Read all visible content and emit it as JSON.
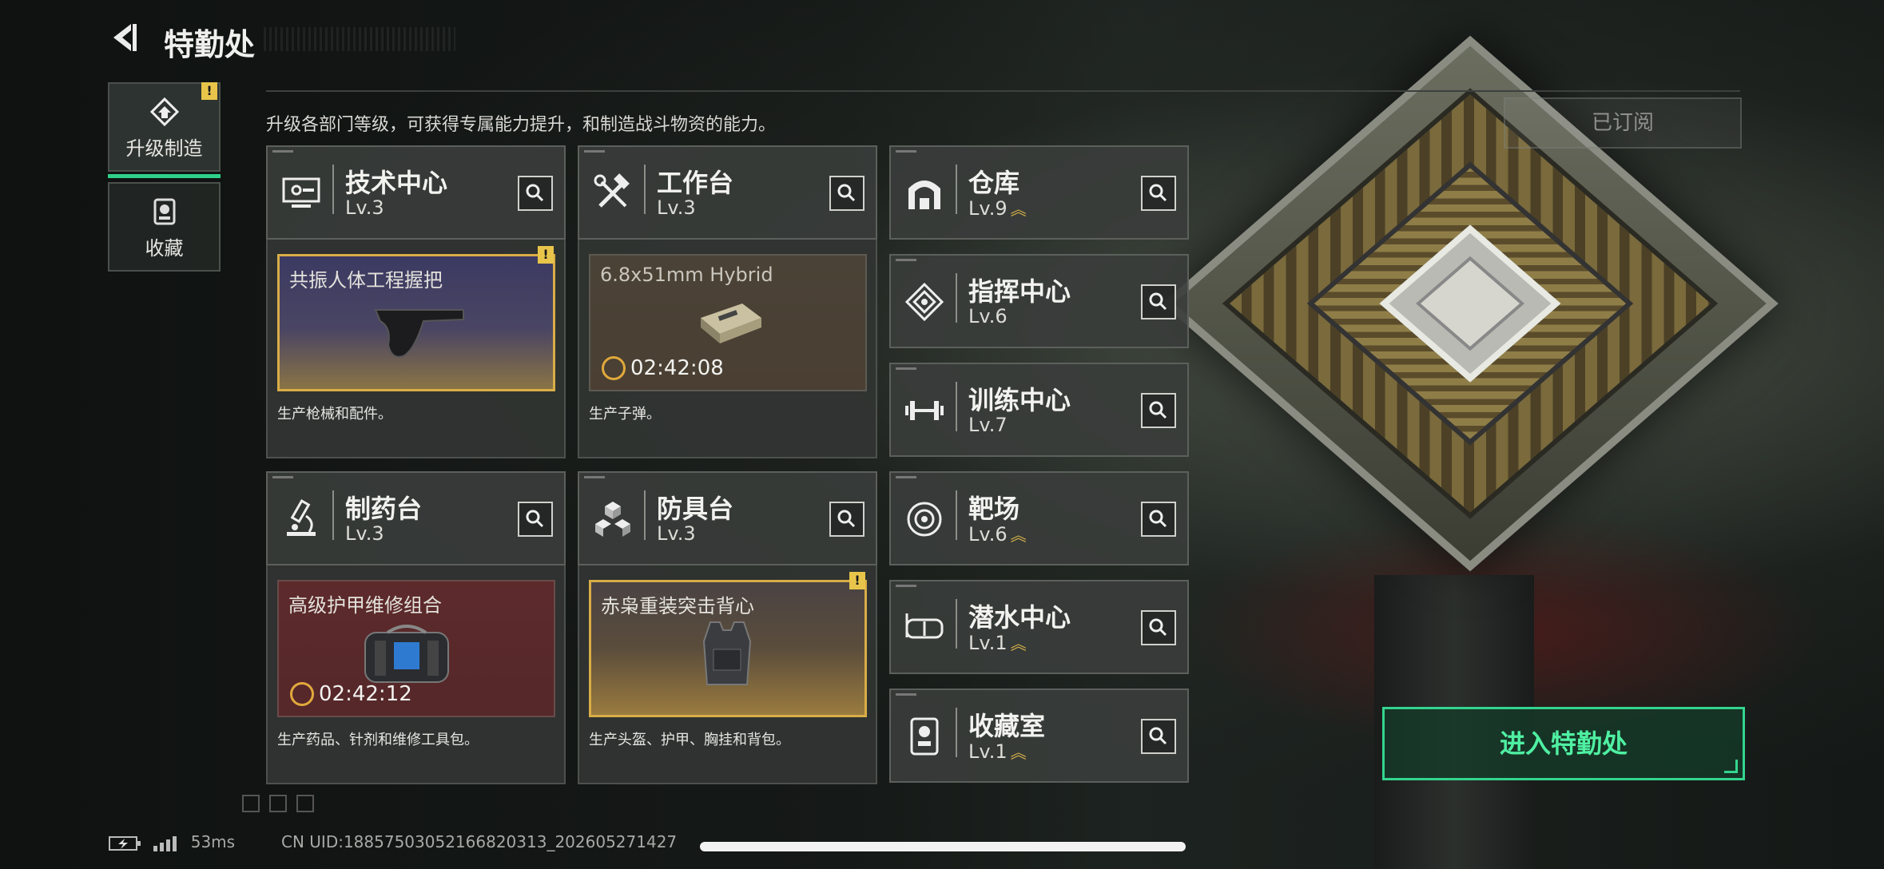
{
  "header": {
    "title": "特勤处",
    "subtitle": "升级各部门等级，可获得专属能力提升，和制造战斗物资的能力。",
    "subscribed_label": "已订阅"
  },
  "sidebar": {
    "tabs": [
      {
        "label": "升级制造",
        "active": true,
        "badge": "!"
      },
      {
        "label": "收藏",
        "active": false
      }
    ]
  },
  "departments": {
    "tech": {
      "name": "技术中心",
      "level": "Lv.3",
      "item": "共振人体工程握把",
      "badge": "!",
      "desc": "生产枪械和配件。"
    },
    "workbench": {
      "name": "工作台",
      "level": "Lv.3",
      "item": "6.8x51mm Hybrid",
      "timer": "02:42:08",
      "desc": "生产子弹。"
    },
    "pharmacy": {
      "name": "制药台",
      "level": "Lv.3",
      "item": "高级护甲维修组合",
      "timer": "02:42:12",
      "desc": "生产药品、针剂和维修工具包。"
    },
    "armor": {
      "name": "防具台",
      "level": "Lv.3",
      "item": "赤枭重装突击背心",
      "badge": "!",
      "desc": "生产头盔、护甲、胸挂和背包。"
    },
    "list": [
      {
        "name": "仓库",
        "level": "Lv.9",
        "upgradable": true
      },
      {
        "name": "指挥中心",
        "level": "Lv.6",
        "upgradable": false
      },
      {
        "name": "训练中心",
        "level": "Lv.7",
        "upgradable": false
      },
      {
        "name": "靶场",
        "level": "Lv.6",
        "upgradable": true
      },
      {
        "name": "潜水中心",
        "level": "Lv.1",
        "upgradable": true
      },
      {
        "name": "收藏室",
        "level": "Lv.1",
        "upgradable": true
      }
    ]
  },
  "enter_button": {
    "label": "进入特勤处"
  },
  "status_bar": {
    "ping": "53ms",
    "uid": "CN UID:18857503052166820313_202605271427"
  },
  "colors": {
    "accent": "#33d58e",
    "badge": "#e8c54a",
    "upgrade_chevron": "#d6b24a"
  },
  "icons": {
    "back": "back-arrow-icon",
    "search": "magnifier-icon",
    "upgrade_chevron": "double-chevron-up-icon",
    "timer": "wrench-timer-icon"
  }
}
